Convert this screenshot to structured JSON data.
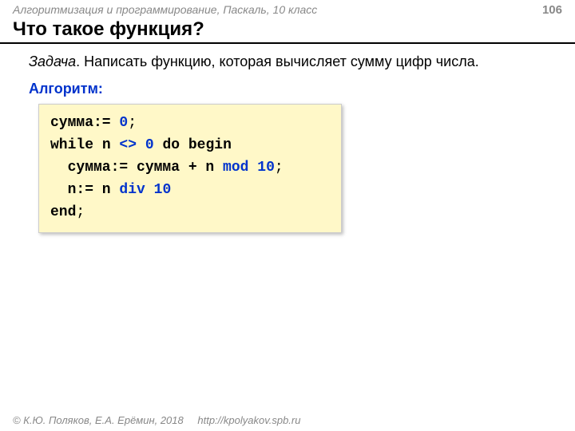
{
  "header": {
    "course": "Алгоритмизация и программирование, Паскаль, 10 класс",
    "page": "106"
  },
  "title": "Что такое функция?",
  "task": {
    "label": "Задача",
    "text": ". Написать функцию, которая вычисляет сумму цифр числа."
  },
  "algo_label": "Алгоритм:",
  "code": {
    "l1a": "сумма:= ",
    "l1b": "0",
    "l1c": ";",
    "l2a": "while",
    "l2b": " n ",
    "l2c": "<>",
    "l2d": " ",
    "l2e": "0",
    "l2f": " ",
    "l2g": "do begin",
    "l3a": "  сумма:= сумма + n ",
    "l3b": "mod",
    "l3c": " ",
    "l3d": "10",
    "l3e": ";",
    "l4a": "  n:= n ",
    "l4b": "div",
    "l4c": " ",
    "l4d": "10",
    "l5a": "end",
    "l5b": ";"
  },
  "footer": {
    "copyright": "© К.Ю. Поляков, Е.А. Ерёмин, 2018",
    "url": "http://kpolyakov.spb.ru"
  }
}
